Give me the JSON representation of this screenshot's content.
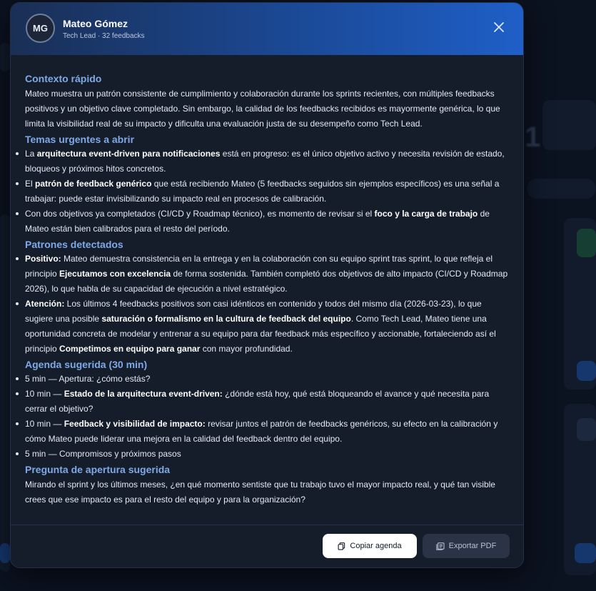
{
  "user": {
    "initials": "MG",
    "name": "Mateo Gómez",
    "subtitle": "Tech Lead · 32 feedbacks"
  },
  "sections": {
    "contexto": {
      "title": "Contexto rápido",
      "text": "Mateo muestra un patrón consistente de cumplimiento y colaboración durante los sprints recientes, con múltiples feedbacks positivos y un objetivo clave completado. Sin embargo, la calidad de los feedbacks recibidos es mayormente genérica, lo que limita la visibilidad real de su impacto y dificulta una evaluación justa de su desempeño como Tech Lead."
    },
    "temas": {
      "title": "Temas urgentes a abrir",
      "items": [
        {
          "pre": "La ",
          "bold": "arquitectura event-driven para notificaciones",
          "post": " está en progreso: es el único objetivo activo y necesita revisión de estado, bloqueos y próximos hitos concretos."
        },
        {
          "pre": "El ",
          "bold": "patrón de feedback genérico",
          "post": " que está recibiendo Mateo (5 feedbacks seguidos sin ejemplos específicos) es una señal a trabajar: puede estar invisibilizando su impacto real en procesos de calibración."
        },
        {
          "pre": "Con dos objetivos ya completados (CI/CD y Roadmap técnico), es momento de revisar si el ",
          "bold": "foco y la carga de trabajo",
          "post": " de Mateo están bien calibrados para el resto del período."
        }
      ]
    },
    "patrones": {
      "title": "Patrones detectados",
      "positivo": {
        "label": "Positivo:",
        "text1": " Mateo demuestra consistencia en la entrega y en la colaboración con su equipo sprint tras sprint, lo que refleja el principio ",
        "bold1": "Ejecutamos con excelencia",
        "text2": " de forma sostenida. También completó dos objetivos de alto impacto (CI/CD y Roadmap 2026), lo que habla de su capacidad de ejecución a nivel estratégico."
      },
      "atencion": {
        "label": "Atención:",
        "text1": " Los últimos 4 feedbacks positivos son casi idénticos en contenido y todos del mismo día (2026-03-23), lo que sugiere una posible ",
        "bold1": "saturación o formalismo en la cultura de feedback del equipo",
        "text2": ". Como Tech Lead, Mateo tiene una oportunidad concreta de modelar y entrenar a su equipo para dar feedback más específico y accionable, fortaleciendo así el principio ",
        "bold2": "Competimos en equipo para ganar",
        "text3": " con mayor profundidad."
      }
    },
    "agenda": {
      "title": "Agenda sugerida (30 min)",
      "items": [
        {
          "pre": "5 min — Apertura: ¿cómo estás?",
          "bold": "",
          "post": ""
        },
        {
          "pre": "10 min — ",
          "bold": "Estado de la arquitectura event-driven:",
          "post": " ¿dónde está hoy, qué está bloqueando el avance y qué necesita para cerrar el objetivo?"
        },
        {
          "pre": "10 min — ",
          "bold": "Feedback y visibilidad de impacto:",
          "post": " revisar juntos el patrón de feedbacks genéricos, su efecto en la calibración y cómo Mateo puede liderar una mejora en la calidad del feedback dentro del equipo."
        },
        {
          "pre": "5 min — Compromisos y próximos pasos",
          "bold": "",
          "post": ""
        }
      ]
    },
    "pregunta": {
      "title": "Pregunta de apertura sugerida",
      "text": "Mirando el sprint y los últimos meses, ¿en qué momento sentiste que tu trabajo tuvo el mayor impacto real, y qué tan visible crees que ese impacto es para el resto del equipo y para la organización?"
    }
  },
  "footer": {
    "copy_label": "Copiar agenda",
    "export_label": "Exportar PDF"
  },
  "icons": {
    "close": "close-icon",
    "copy": "copy-icon",
    "export": "document-icon"
  },
  "colors": {
    "header_start": "#1a2f55",
    "header_end": "#1f5fc7",
    "section_title": "#7fa9e6",
    "modal_bg": "#151d2b"
  }
}
